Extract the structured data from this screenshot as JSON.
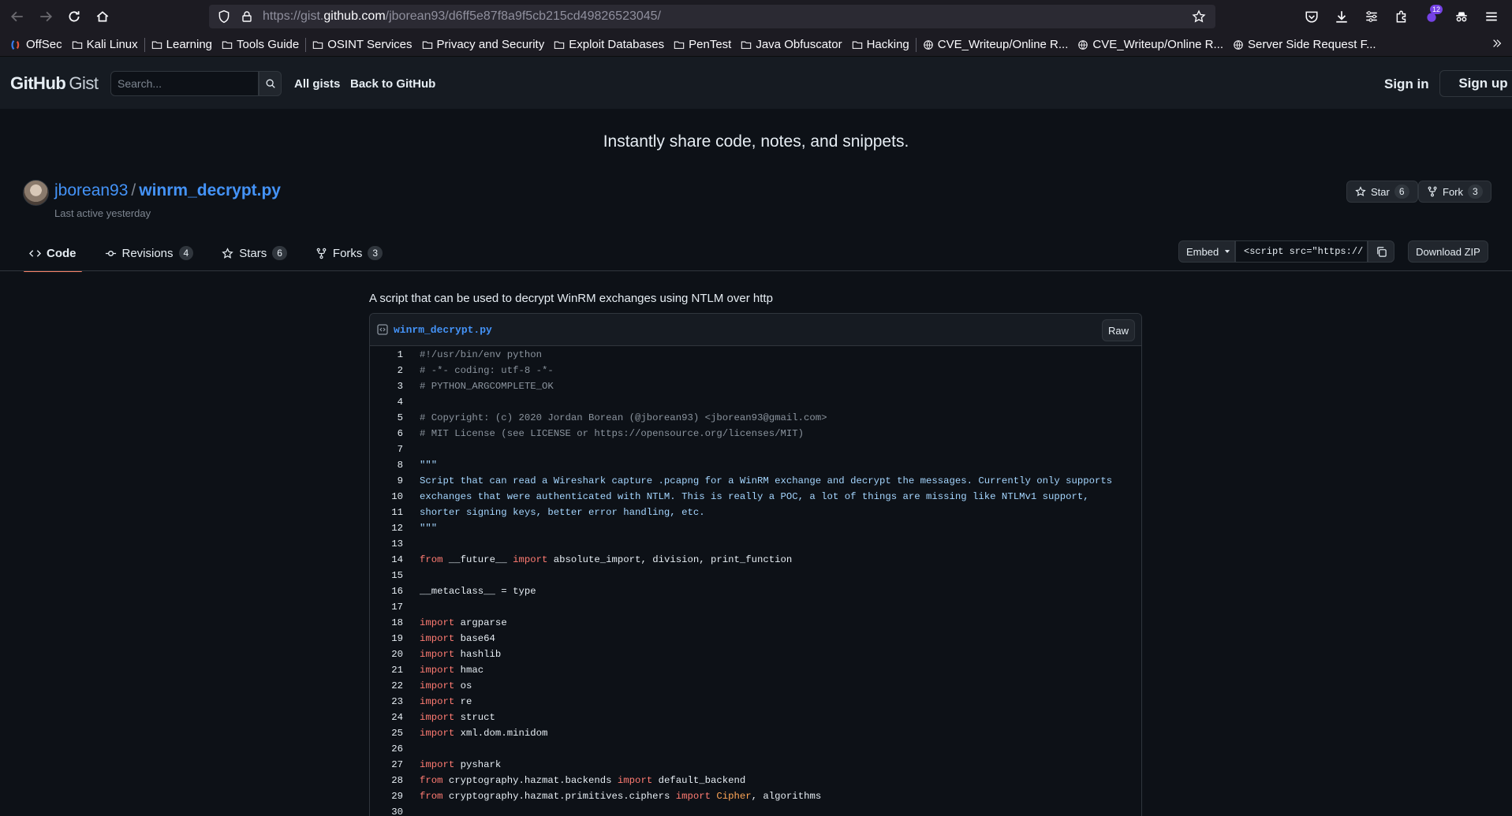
{
  "browser": {
    "url_prefix": "https://gist.",
    "url_host": "github.com",
    "url_path": "/jborean93/d6ff5e87f8a9f5cb215cd49826523045/",
    "extension_badge": "12",
    "bookmarks": [
      {
        "label": "OffSec",
        "icon": "offsec-icon"
      },
      {
        "label": "Kali Linux",
        "icon": "folder-icon"
      },
      {
        "label": "Learning",
        "icon": "folder-icon"
      },
      {
        "label": "Tools Guide",
        "icon": "folder-icon"
      },
      {
        "label": "OSINT Services",
        "icon": "folder-icon"
      },
      {
        "label": "Privacy and Security",
        "icon": "folder-icon"
      },
      {
        "label": "Exploit Databases",
        "icon": "folder-icon"
      },
      {
        "label": "PenTest",
        "icon": "folder-icon"
      },
      {
        "label": "Java Obfuscator",
        "icon": "folder-icon"
      },
      {
        "label": "Hacking",
        "icon": "folder-icon"
      },
      {
        "label": "CVE_Writeup/Online R...",
        "icon": "globe-icon"
      },
      {
        "label": "CVE_Writeup/Online R...",
        "icon": "globe-icon"
      },
      {
        "label": "Server Side Request F...",
        "icon": "globe-icon"
      }
    ]
  },
  "header": {
    "logo_github": "GitHub",
    "logo_gist": "Gist",
    "search_placeholder": "Search...",
    "all_gists": "All gists",
    "back_to_github": "Back to GitHub",
    "sign_in": "Sign in",
    "sign_up": "Sign up"
  },
  "tagline": "Instantly share code, notes, and snippets.",
  "gist": {
    "owner": "jborean93",
    "separator": "/",
    "filename": "winrm_decrypt.py",
    "last_active": "Last active yesterday",
    "star_label": "Star",
    "star_count": "6",
    "fork_label": "Fork",
    "fork_count": "3",
    "description": "A script that can be used to decrypt WinRM exchanges using NTLM over http"
  },
  "tabs": [
    {
      "label": "Code",
      "count": null,
      "active": true
    },
    {
      "label": "Revisions",
      "count": "4"
    },
    {
      "label": "Stars",
      "count": "6"
    },
    {
      "label": "Forks",
      "count": "3"
    }
  ],
  "embed": {
    "label": "Embed",
    "value": "<script src=\"https://",
    "download": "Download ZIP"
  },
  "file": {
    "name": "winrm_decrypt.py",
    "raw": "Raw",
    "lines": [
      [
        [
          "cmt",
          "#!/usr/bin/env python"
        ]
      ],
      [
        [
          "cmt",
          "# -*- coding: utf-8 -*-"
        ]
      ],
      [
        [
          "cmt",
          "# PYTHON_ARGCOMPLETE_OK"
        ]
      ],
      [],
      [
        [
          "cmt",
          "# Copyright: (c) 2020 Jordan Borean (@jborean93) <jborean93@gmail.com>"
        ]
      ],
      [
        [
          "cmt",
          "# MIT License (see LICENSE or https://opensource.org/licenses/MIT)"
        ]
      ],
      [],
      [
        [
          "str",
          "\"\"\""
        ]
      ],
      [
        [
          "str",
          "Script that can read a Wireshark capture .pcapng for a WinRM exchange and decrypt the messages. Currently only supports"
        ]
      ],
      [
        [
          "str",
          "exchanges that were authenticated with NTLM. This is really a POC, a lot of things are missing like NTLMv1 support,"
        ]
      ],
      [
        [
          "str",
          "shorter signing keys, better error handling, etc."
        ]
      ],
      [
        [
          "str",
          "\"\"\""
        ]
      ],
      [],
      [
        [
          "kw",
          "from"
        ],
        [
          "",
          " __future__ "
        ],
        [
          "kw",
          "import"
        ],
        [
          "",
          " absolute_import, division, print_function"
        ]
      ],
      [],
      [
        [
          "",
          "__metaclass__ = type"
        ]
      ],
      [],
      [
        [
          "kw",
          "import"
        ],
        [
          "",
          " argparse"
        ]
      ],
      [
        [
          "kw",
          "import"
        ],
        [
          "",
          " base64"
        ]
      ],
      [
        [
          "kw",
          "import"
        ],
        [
          "",
          " hashlib"
        ]
      ],
      [
        [
          "kw",
          "import"
        ],
        [
          "",
          " hmac"
        ]
      ],
      [
        [
          "kw",
          "import"
        ],
        [
          "",
          " os"
        ]
      ],
      [
        [
          "kw",
          "import"
        ],
        [
          "",
          " re"
        ]
      ],
      [
        [
          "kw",
          "import"
        ],
        [
          "",
          " struct"
        ]
      ],
      [
        [
          "kw",
          "import"
        ],
        [
          "",
          " xml.dom.minidom"
        ]
      ],
      [],
      [
        [
          "kw",
          "import"
        ],
        [
          "",
          " pyshark"
        ]
      ],
      [
        [
          "kw",
          "from"
        ],
        [
          "",
          " cryptography.hazmat.backends "
        ],
        [
          "kw",
          "import"
        ],
        [
          "",
          " default_backend"
        ]
      ],
      [
        [
          "kw",
          "from"
        ],
        [
          "",
          " cryptography.hazmat.primitives.ciphers "
        ],
        [
          "kw",
          "import"
        ],
        [
          "cls",
          " Cipher"
        ],
        [
          "",
          ", algorithms"
        ]
      ],
      []
    ]
  },
  "colors": {
    "page_bg": "#0d1117",
    "header_bg": "#161b22",
    "link": "#4493f8",
    "active_tab_underline": "#f78166",
    "keyword": "#ff7b72",
    "string": "#a5d6ff",
    "comment": "#8b949e"
  }
}
